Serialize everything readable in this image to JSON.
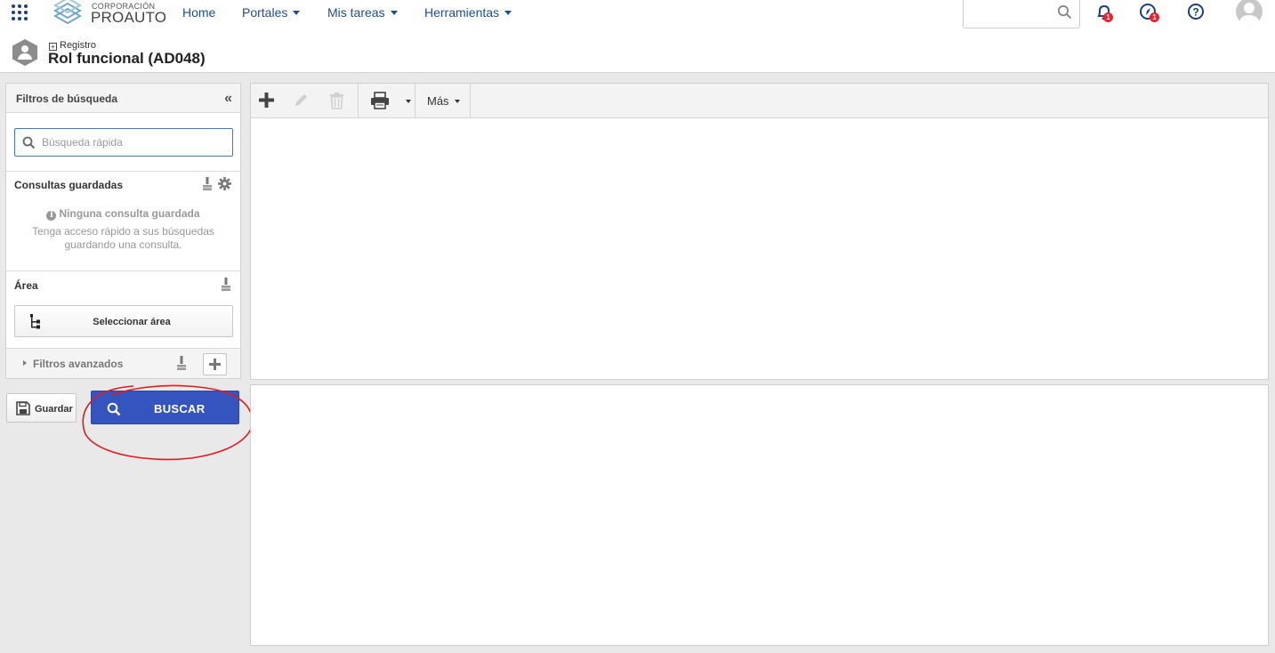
{
  "nav": {
    "logo_line1": "CORPORACIÓN",
    "logo_line2": "PROAUTO",
    "links": [
      {
        "label": "Home",
        "has_caret": false
      },
      {
        "label": "Portales",
        "has_caret": true
      },
      {
        "label": "Mis tareas",
        "has_caret": true
      },
      {
        "label": "Herramientas",
        "has_caret": true
      }
    ],
    "search": {
      "placeholder": "",
      "value": ""
    },
    "notifications_count": "1",
    "tasks_count": "1",
    "icons": [
      "apps-grid-icon",
      "bell-icon",
      "compass-icon",
      "help-icon",
      "avatar"
    ]
  },
  "header": {
    "breadcrumb": "Registro",
    "title": "Rol funcional (AD048)"
  },
  "filters": {
    "title": "Filtros de búsqueda",
    "collapse_glyph": "«",
    "quick_search_placeholder": "Búsqueda rápida",
    "saved_queries": {
      "label": "Consultas guardadas",
      "empty_title": "Ninguna consulta guardada",
      "empty_desc": "Tenga acceso rápido a sus búsquedas guardando una consulta."
    },
    "area": {
      "label": "Área",
      "button": "Seleccionar área"
    },
    "advanced": {
      "label": "Filtros avanzados"
    }
  },
  "actions": {
    "save": "Guardar",
    "search": "BUSCAR"
  },
  "toolbar": {
    "more": "Más",
    "icons": [
      "add-icon",
      "edit-icon",
      "delete-icon",
      "print-icon"
    ]
  },
  "colors": {
    "nav_link": "#1d4f8f",
    "primary_button": "#3654be",
    "badge": "#e5232f",
    "annotation": "#e0191b"
  }
}
